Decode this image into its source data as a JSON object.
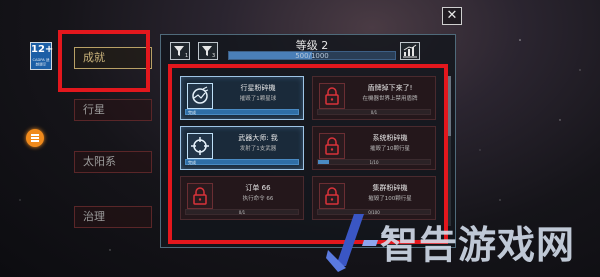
{
  "age_rating": {
    "number": "12+",
    "caption": "CADPA 适龄提示"
  },
  "close_label": "✕",
  "side_nav": [
    {
      "label": "成就",
      "active": true
    },
    {
      "label": "行星",
      "active": false
    },
    {
      "label": "太阳系",
      "active": false
    },
    {
      "label": "治理",
      "active": false
    }
  ],
  "header": {
    "level_title": "等级 2",
    "level_progress": "500/1000",
    "level_progress_fraction": 0.5
  },
  "achievements": [
    {
      "title": "行星粉碎機",
      "desc": "摧毁了1颗星球",
      "progress": "完成",
      "progress_fraction": 1.0,
      "completed": true,
      "icon": "planet-smash-icon"
    },
    {
      "title": "盾牌掉下来了!",
      "desc": "在機器世界上禁用盾牌",
      "progress": "0/1",
      "progress_fraction": 0.0,
      "completed": false,
      "icon": "lock-icon"
    },
    {
      "title": "武器大师: 我",
      "desc": "发射了1支武器",
      "progress": "完成",
      "progress_fraction": 1.0,
      "completed": true,
      "icon": "crosshair-icon"
    },
    {
      "title": "系统粉碎機",
      "desc": "摧毁了10颗行星",
      "progress": "1/10",
      "progress_fraction": 0.1,
      "completed": false,
      "icon": "lock-icon"
    },
    {
      "title": "订单 66",
      "desc": "执行命令 66",
      "progress": "0/1",
      "progress_fraction": 0.0,
      "completed": false,
      "icon": "lock-icon"
    },
    {
      "title": "集群粉碎機",
      "desc": "摧毁了100颗行星",
      "progress": "0/100",
      "progress_fraction": 0.0,
      "completed": false,
      "icon": "lock-icon"
    }
  ],
  "watermark": "智告游戏网",
  "colors": {
    "highlight_red": "#e3171d",
    "completed_blue": "#4a8ac2",
    "gold_accent": "#c8b27a",
    "menu_orange": "#f08a1c"
  }
}
